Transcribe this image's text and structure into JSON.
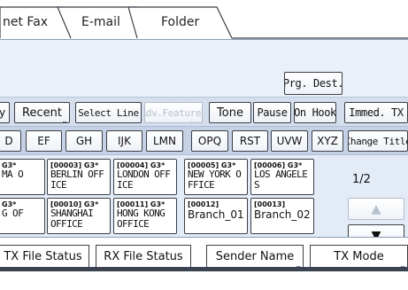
{
  "tabs": [
    {
      "label": "net Fax"
    },
    {
      "label": "E-mail"
    },
    {
      "label": "Folder"
    }
  ],
  "prg_dest_button": {
    "label": "Prg. Dest."
  },
  "toolbar": {
    "partial_left": "y",
    "recent": "Recent",
    "select_line": "Select Line",
    "adv_features": "Adv.Features",
    "tone": "Tone",
    "pause": "Pause",
    "on_hook": "On Hook",
    "immed_tx": "Immed. TX"
  },
  "index_tabs": [
    "D",
    "EF",
    "GH",
    "IJK",
    "LMN",
    "OPQ",
    "RST",
    "UVW",
    "XYZ"
  ],
  "change_title": "Change Title",
  "destinations": [
    {
      "hdr": "G3*",
      "name1": "MA O",
      "name2": ""
    },
    {
      "hdr": "[00003] G3*",
      "name1": "BERLIN OFF",
      "name2": "ICE"
    },
    {
      "hdr": "[00004] G3*",
      "name1": "LONDON OFF",
      "name2": "ICE"
    },
    {
      "hdr": "[00005] G3*",
      "name1": "NEW YORK O",
      "name2": "FFICE"
    },
    {
      "hdr": "[00006] G3*",
      "name1": "LOS ANGELE",
      "name2": "S"
    },
    {
      "hdr": "G3*",
      "name1": "G OF",
      "name2": ""
    },
    {
      "hdr": "[00010] G3*",
      "name1": "SHANGHAI",
      "name2": "OFFICE"
    },
    {
      "hdr": "[00011] G3*",
      "name1": "HONG KONG",
      "name2": "OFFICE"
    },
    {
      "hdr": "[00012]",
      "name1": "Branch_01",
      "name2": ""
    },
    {
      "hdr": "[00013]",
      "name1": "Branch_02",
      "name2": ""
    }
  ],
  "page_indicator": "1/2",
  "bottom_tabs": [
    {
      "label": "TX File Status"
    },
    {
      "label": "RX File Status"
    },
    {
      "label": "Sender Name"
    },
    {
      "label": "TX Mode"
    }
  ],
  "colors": {
    "panel_bg": "#e3ebf6",
    "tab_border": "#3a3f48"
  }
}
